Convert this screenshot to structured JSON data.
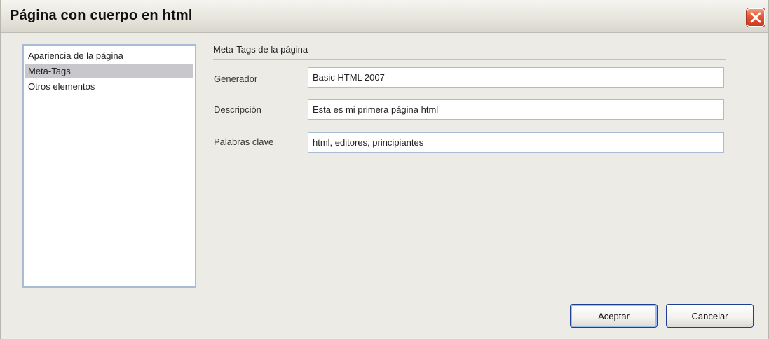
{
  "window": {
    "title": "Página con cuerpo en html"
  },
  "sidebar": {
    "items": [
      {
        "label": "Apariencia de la página",
        "selected": false
      },
      {
        "label": "Meta-Tags",
        "selected": true
      },
      {
        "label": "Otros elementos",
        "selected": false
      }
    ]
  },
  "section": {
    "title": "Meta-Tags de la página"
  },
  "fields": [
    {
      "label": "Generador",
      "value": "Basic HTML 2007"
    },
    {
      "label": "Descripción",
      "value": "Esta es mi primera página html"
    },
    {
      "label": "Palabras clave",
      "value": "html, editores, principiantes"
    }
  ],
  "buttons": {
    "ok_label": "Aceptar",
    "cancel_label": "Cancelar"
  },
  "icons": {
    "close": "close-icon"
  },
  "colors": {
    "dialog_background": "#ecebe6",
    "selection": "#c8c8cc",
    "close_button": "#e0583a",
    "button_border": "#1c3f94"
  }
}
